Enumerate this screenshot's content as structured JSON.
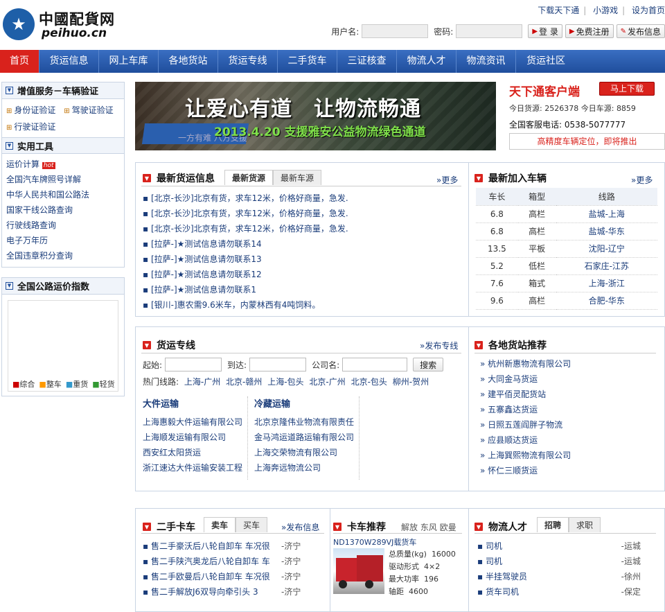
{
  "logo": {
    "cn": "中國配貨网",
    "en": "peihuo.cn"
  },
  "toplinks": [
    "下载天下通",
    "小游戏",
    "设为首页"
  ],
  "login": {
    "user_label": "用户名:",
    "pass_label": "密码:",
    "login_btn": "登 录",
    "register_btn": "免费注册",
    "publish_btn": "发布信息"
  },
  "nav": [
    "首页",
    "货运信息",
    "网上车库",
    "各地货站",
    "货运专线",
    "二手货车",
    "三证核查",
    "物流人才",
    "物流资讯",
    "货运社区"
  ],
  "sidebar": {
    "vas_title": "增值服务－车辆验证",
    "vas_items": [
      "身份证验证",
      "驾驶证验证",
      "行驶证验证"
    ],
    "tools_title": "实用工具",
    "tools_items": [
      "运价计算",
      "全国汽车牌照号详解",
      "中华人民共和国公路法",
      "国家干线公路查询",
      "行驶线路查询",
      "电子万年历",
      "全国违章积分查询"
    ],
    "hot": "hot",
    "index_title": "全国公路运价指数",
    "legend": [
      "综合",
      "整车",
      "重货",
      "轻货"
    ]
  },
  "banner": {
    "line1": "让爱心有道　让物流畅通",
    "line2": "2013.4.20 支援雅安公益物流绿色通道",
    "watermark": "一方有难 八方支援"
  },
  "client": {
    "title": "天下通客户端",
    "download": "马上下载",
    "today_cargo_label": "今日货源:",
    "today_cargo": "2526378",
    "today_truck_label": "今日车源:",
    "today_truck": "8859",
    "hotline": "全国客服电话: 0538-5077777",
    "notice": "高精度车辆定位，即将推出"
  },
  "cargo": {
    "title": "最新货运信息",
    "tabs": [
      "最新货源",
      "最新车源"
    ],
    "more": "更多",
    "items": [
      "[北京-长沙]北京有货，求车12米，价格好商量，急发.",
      "[北京-长沙]北京有货，求车12米，价格好商量，急发.",
      "[北京-长沙]北京有货，求车12米，价格好商量，急发.",
      "[拉萨-]★测试信息请勿联系14",
      "[拉萨-]★测试信息请勿联系13",
      "[拉萨-]★测试信息请勿联系12",
      "[拉萨-]★测试信息请勿联系1",
      "[银川-]惠农需9.6米车，内蒙林西有4吨饲料。"
    ]
  },
  "vehicles": {
    "title": "最新加入车辆",
    "more": "更多",
    "headers": [
      "车长",
      "箱型",
      "线路"
    ],
    "rows": [
      [
        "6.8",
        "高栏",
        "盐城-上海"
      ],
      [
        "6.8",
        "高栏",
        "盐城-华东"
      ],
      [
        "13.5",
        "平板",
        "沈阳-辽宁"
      ],
      [
        "5.2",
        "低栏",
        "石家庄-江苏"
      ],
      [
        "7.6",
        "箱式",
        "上海-浙江"
      ],
      [
        "9.6",
        "高栏",
        "合肥-华东"
      ]
    ]
  },
  "lines": {
    "title": "货运专线",
    "publish": "发布专线",
    "from_label": "起始:",
    "to_label": "到达:",
    "company_label": "公司名:",
    "search_btn": "搜索",
    "hot_label": "热门线路:",
    "hot": [
      "上海-广州",
      "北京-赣州",
      "上海-包头",
      "北京-广州",
      "北京-包头",
      "柳州-贺州"
    ],
    "col1_title": "大件运输",
    "col1": [
      "上海惠毅大件运输有限公司",
      "上海顺发运输有限公司",
      "西安红太阳货运",
      "浙江速达大件运输安装工程"
    ],
    "col2_title": "冷藏运输",
    "col2": [
      "北京京隆伟业物流有限责任",
      "金马鸿运道路运输有限公司",
      "上海交荣物流有限公司",
      "上海奔远物流公司"
    ]
  },
  "stations": {
    "title": "各地货站推荐",
    "items": [
      "杭州新惠物流有限公司",
      "大同金马货运",
      "建平佰灵配货站",
      "五寨鑫达货运",
      "日照五莲阎胖子物流",
      "应县顺达货运",
      "上海巽熙物流有限公司",
      "怀仁三顺货运"
    ]
  },
  "used": {
    "title": "二手卡车",
    "tabs": [
      "卖车",
      "买车"
    ],
    "publish": "发布信息",
    "items": [
      [
        "售二手豪沃后八轮自卸车 车况很",
        "-济宁"
      ],
      [
        "售二手陕汽奥龙后八轮自卸车 车",
        "-济宁"
      ],
      [
        "售二手欧曼后八轮自卸车 车况很",
        "-济宁"
      ],
      [
        "售二手解放J6双导向牵引头 3",
        "-济宁"
      ]
    ]
  },
  "truck": {
    "title": "卡车推荐",
    "brands": [
      "解放",
      "东风",
      "欧曼"
    ],
    "model": "ND1370W289VJ载货车",
    "specs": [
      [
        "总质量(kg)",
        "16000"
      ],
      [
        "驱动形式",
        "4×2"
      ],
      [
        "最大功率",
        "196"
      ],
      [
        "轴距",
        "4600"
      ]
    ]
  },
  "talent": {
    "title": "物流人才",
    "tabs": [
      "招聘",
      "求职"
    ],
    "items": [
      [
        "司机",
        "-运城"
      ],
      [
        "司机",
        "-运城"
      ],
      [
        "半挂驾驶员",
        "-徐州"
      ],
      [
        "货车司机",
        "-保定"
      ]
    ]
  },
  "colors": {
    "nav": "#1f4e9c",
    "accent": "#d9221c"
  }
}
